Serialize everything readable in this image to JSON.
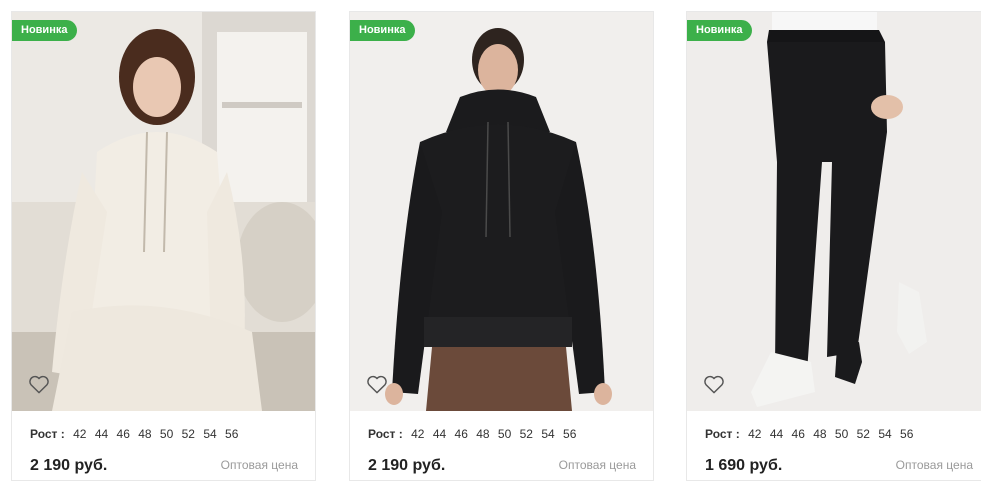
{
  "products": [
    {
      "badge": "Новинка",
      "sizes_label": "Рост :",
      "sizes": [
        "42",
        "44",
        "46",
        "48",
        "50",
        "52",
        "54",
        "56"
      ],
      "price": "2 190 руб.",
      "wholesale": "Оптовая цена",
      "favorite_icon": "heart-outline-icon"
    },
    {
      "badge": "Новинка",
      "sizes_label": "Рост :",
      "sizes": [
        "42",
        "44",
        "46",
        "48",
        "50",
        "52",
        "54",
        "56"
      ],
      "price": "2 190 руб.",
      "wholesale": "Оптовая цена",
      "favorite_icon": "heart-outline-icon"
    },
    {
      "badge": "Новинка",
      "sizes_label": "Рост :",
      "sizes": [
        "42",
        "44",
        "46",
        "48",
        "50",
        "52",
        "54",
        "56"
      ],
      "price": "1 690 руб.",
      "wholesale": "Оптовая цена",
      "favorite_icon": "heart-outline-icon"
    }
  ],
  "colors": {
    "badge": "#3cb04a",
    "wholesale_text": "#9a9a9a",
    "card_border": "#e8e8e8"
  }
}
